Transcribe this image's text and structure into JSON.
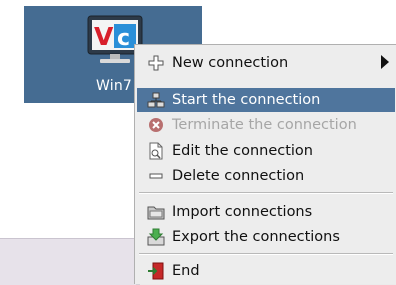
{
  "desktop": {
    "tile_label": "Win7",
    "tile_color": "#456c92"
  },
  "menu": {
    "items": [
      {
        "label": "New connection",
        "icon": "plus-icon",
        "state": "normal",
        "submenu": true
      },
      {
        "label": "Start the connection",
        "icon": "start-icon",
        "state": "hover"
      },
      {
        "label": "Terminate the connection",
        "icon": "terminate-icon",
        "state": "disabled"
      },
      {
        "label": "Edit the connection",
        "icon": "edit-icon",
        "state": "normal"
      },
      {
        "label": "Delete connection",
        "icon": "minus-icon",
        "state": "normal"
      },
      {
        "label": "Import connections",
        "icon": "import-icon",
        "state": "normal"
      },
      {
        "label": "Export the connections",
        "icon": "export-icon",
        "state": "normal"
      },
      {
        "label": "End",
        "icon": "exit-icon",
        "state": "normal"
      }
    ],
    "highlight_color": "#4f759d"
  }
}
